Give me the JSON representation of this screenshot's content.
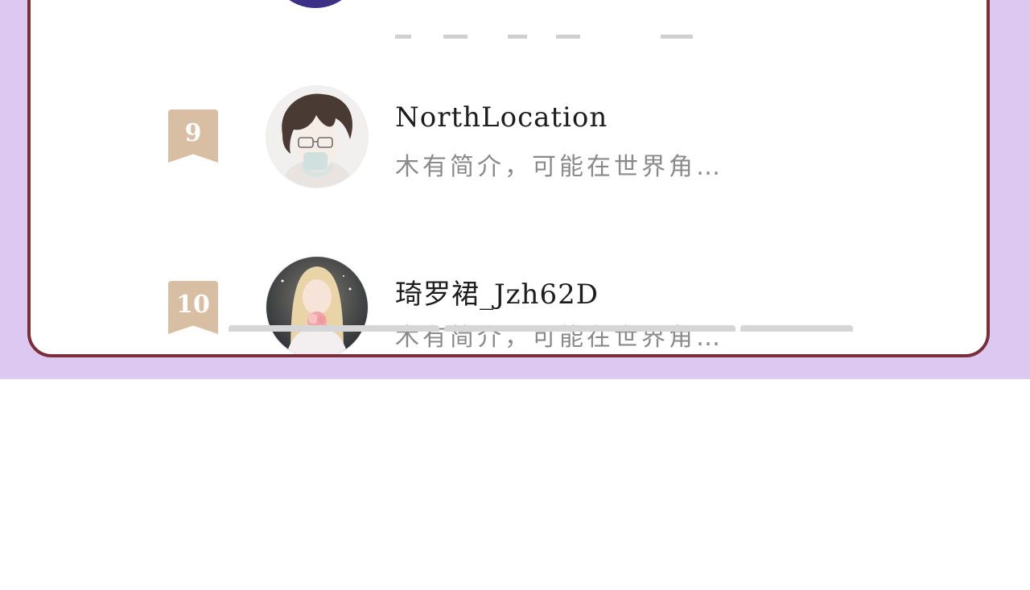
{
  "entries": [
    {
      "rank": "9",
      "name": "NorthLocation",
      "description": "木有简介，可能在世界角…",
      "avatar_icon": "anime-man-glasses-avatar"
    },
    {
      "rank": "10",
      "name": "琦罗裙_Jzh62D",
      "description": "木有简介，可能在世界角…",
      "avatar_icon": "anime-girl-rose-avatar"
    }
  ],
  "colors": {
    "page_background": "#dcc8f0",
    "card_border": "#7a2e3a",
    "rank_badge": "#d8bfa3",
    "name_text": "#1d1d1d",
    "description_text": "#8a8a8a"
  }
}
